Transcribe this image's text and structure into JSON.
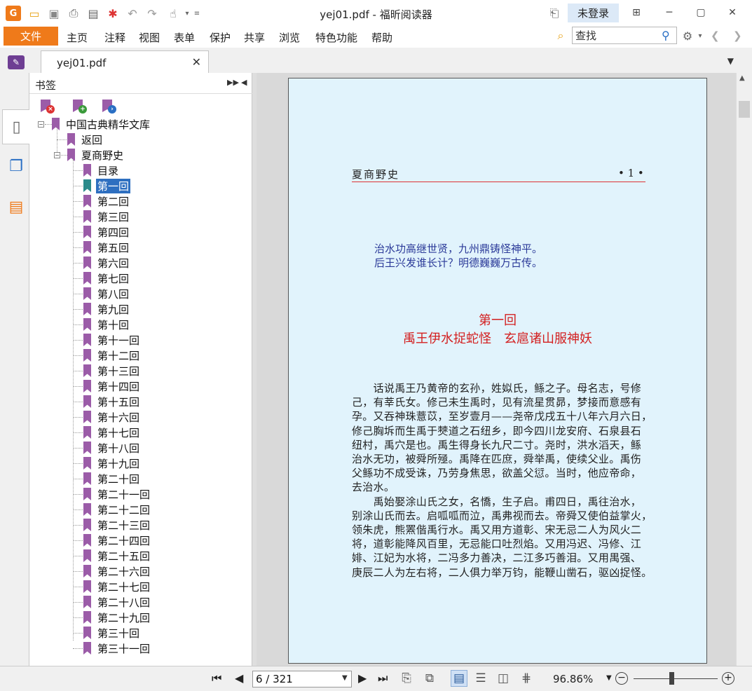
{
  "window": {
    "title": "yej01.pdf - 福昕阅读器",
    "login_label": "未登录"
  },
  "menubar": {
    "file_label": "文件",
    "items": [
      "主页",
      "注释",
      "视图",
      "表单",
      "保护",
      "共享",
      "浏览",
      "特色功能",
      "帮助"
    ],
    "find_placeholder": "查找"
  },
  "tab": {
    "label": "yej01.pdf"
  },
  "bookmark_panel": {
    "title": "书签",
    "tree": {
      "root": "中国古典精华文库",
      "return": "返回",
      "book": "夏商野史",
      "chapters": [
        "目录",
        "第一回",
        "第二回",
        "第三回",
        "第四回",
        "第五回",
        "第六回",
        "第七回",
        "第八回",
        "第九回",
        "第十回",
        "第十一回",
        "第十二回",
        "第十三回",
        "第十四回",
        "第十五回",
        "第十六回",
        "第十七回",
        "第十八回",
        "第十九回",
        "第二十回",
        "第二十一回",
        "第二十二回",
        "第二十三回",
        "第二十四回",
        "第二十五回",
        "第二十六回",
        "第二十七回",
        "第二十八回",
        "第二十九回",
        "第三十回",
        "第三十一回"
      ],
      "selected_index": 1
    }
  },
  "document": {
    "running_head": "夏商野史",
    "page_number": "• 1 •",
    "poem": [
      "治水功高继世贤，九州鼎铸怪神平。",
      "后王兴发谁长计？明德巍巍万古传。"
    ],
    "chapter_number": "第一回",
    "chapter_title": "禹王伊水捉蛇怪　玄扈诸山服神妖",
    "body": [
      "　　话说禹王乃黄帝的玄孙，姓姒氏，鲧之子。母名志，号修",
      "己，有莘氏女。修己未生禹时，见有流星贯昴，梦接而意感有",
      "孕。又吞神珠薏苡，至岁壹月——尧帝戊戌五十八年六月六日，",
      "修己胸坼而生禹于僰道之石纽乡，即今四川龙安府、石泉县石",
      "纽村，禹穴是也。禹生得身长九尺二寸。尧时，洪水滔天，鲧",
      "治水无功，被舜所殛。禹降在匹庶，舜举禹，使续父业。禹伤",
      "父鲧功不成受诛，乃劳身焦思，欲盖父愆。当时，他应帝命，",
      "去治水。",
      "　　禹始娶涂山氏之女，名憍，生子启。甫四日，禹往治水，",
      "别涂山氏而去。启呱呱而泣，禹弗视而去。帝舜又使伯益掌火，",
      "领朱虎，熊罴偕禹行水。禹又用方道彰、宋无忌二人为风火二",
      "将，道彰能降风百里，无忌能口吐烈焰。又用冯迟、冯修、江",
      "婔、江妃为水将，二冯多力善决，二江多巧善泪。又用禺强、",
      "庚辰二人为左右将，二人俱力举万钧，能鞭山凿石，驱凶捉怪。"
    ]
  },
  "statusbar": {
    "page_field": "6 / 321",
    "zoom": "96.86%"
  },
  "colors": {
    "accent": "#ef7a1a",
    "bookmark": "#9b5ca8",
    "selection": "#2e6fc0",
    "chapter_red": "#d31f1f",
    "poem_blue": "#2b3a99",
    "page_bg": "#e1f3fc"
  }
}
